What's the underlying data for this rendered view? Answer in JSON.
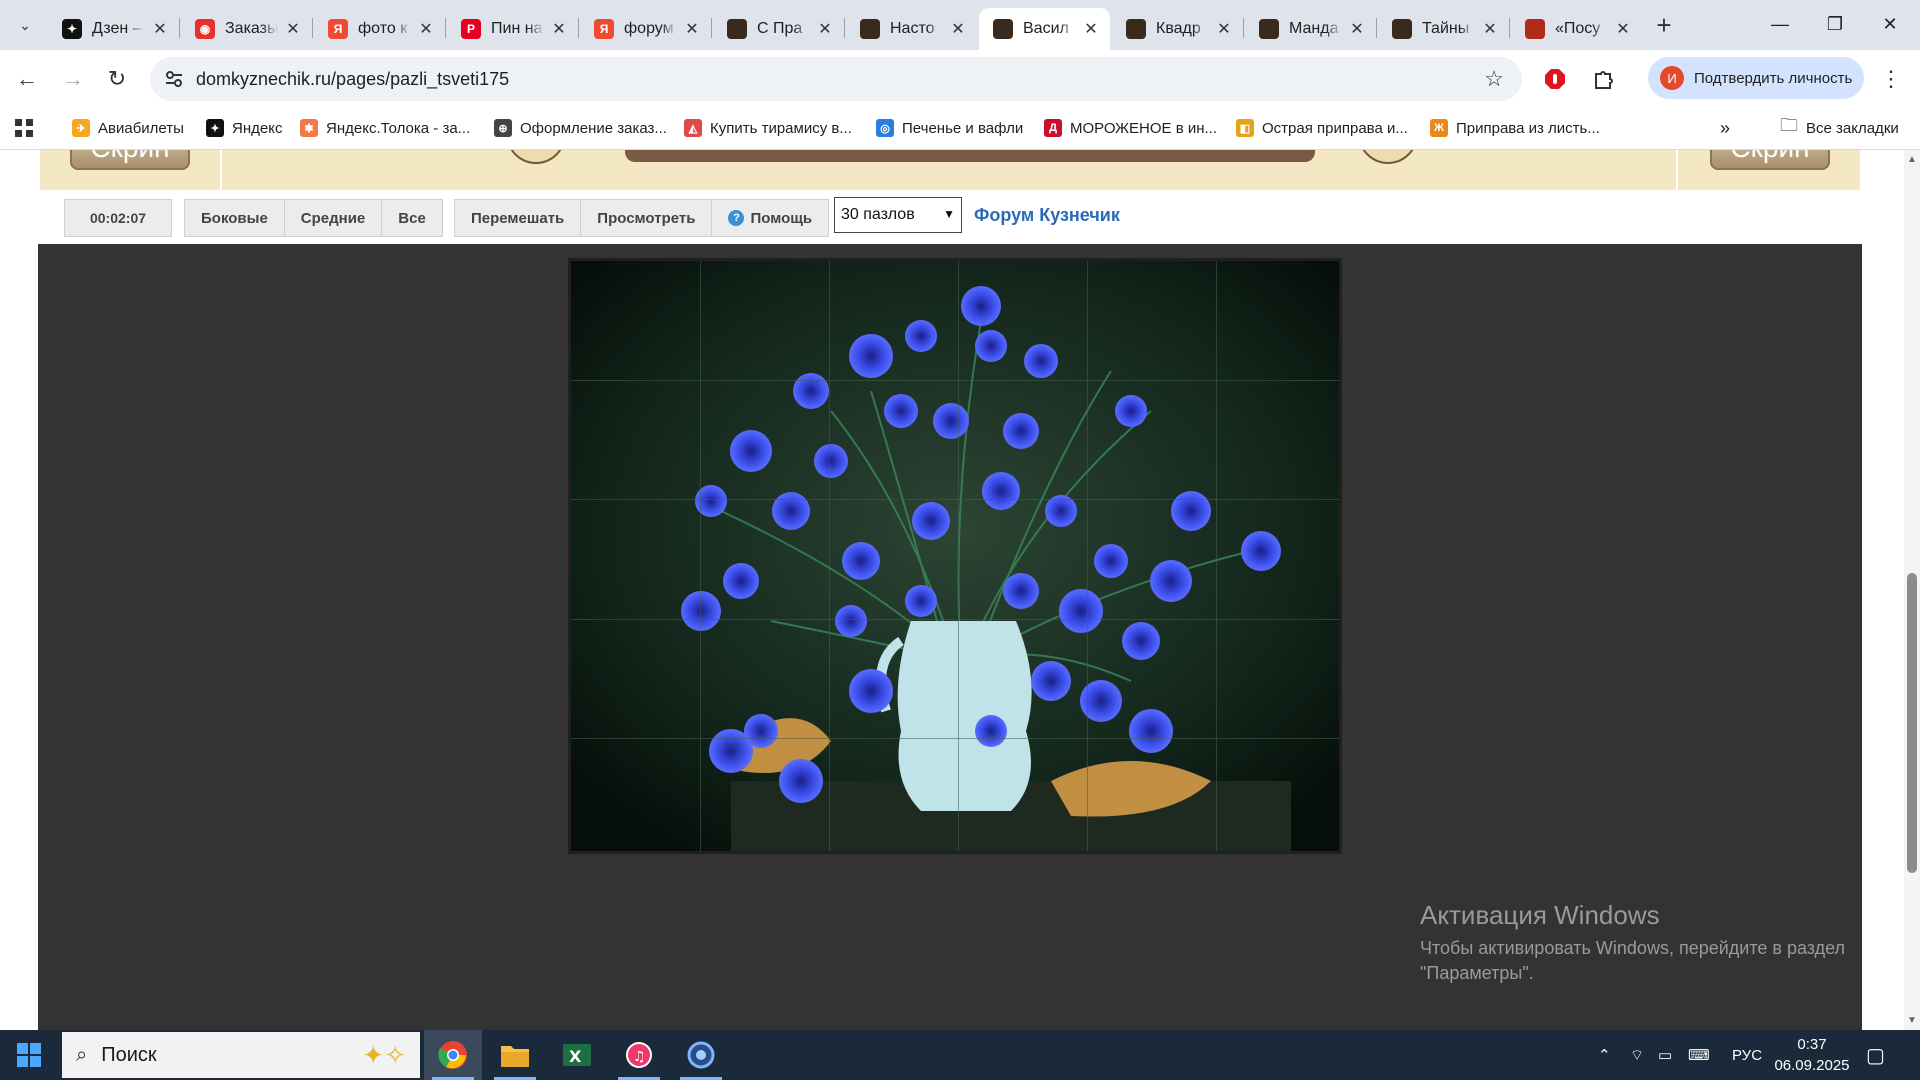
{
  "browser": {
    "tabs": [
      {
        "title": "Дзен – ",
        "color": "#111111",
        "glyph": "✦"
      },
      {
        "title": "Заказы",
        "color": "#e4322b",
        "glyph": "◉"
      },
      {
        "title": "фото к",
        "color": "#f04a31",
        "glyph": "Я"
      },
      {
        "title": "Пин на",
        "color": "#e60023",
        "glyph": "P"
      },
      {
        "title": "форум",
        "color": "#f04a31",
        "glyph": "Я"
      },
      {
        "title": "С Пра",
        "color": "#3a2a1e",
        "glyph": ""
      },
      {
        "title": "Насто",
        "color": "#3a2a1e",
        "glyph": ""
      },
      {
        "title": "Васил",
        "color": "#3a2a1e",
        "glyph": "",
        "active": true
      },
      {
        "title": "Квадр",
        "color": "#3a2a1e",
        "glyph": ""
      },
      {
        "title": "Манда",
        "color": "#3a2a1e",
        "glyph": ""
      },
      {
        "title": "Тайны",
        "color": "#3a2a1e",
        "glyph": ""
      },
      {
        "title": "«Посу",
        "color": "#b02a1a",
        "glyph": ""
      }
    ],
    "url": "domkyznechik.ru/pages/pazli_tsveti175",
    "profile_label": "Подтвердить личность",
    "profile_initial": "И",
    "bookmarks": [
      {
        "label": "Авиабилеты",
        "color": "#f5a623",
        "glyph": "✈"
      },
      {
        "label": "Яндекс",
        "color": "#111111",
        "glyph": "✦"
      },
      {
        "label": "Яндекс.Толока - за...",
        "color": "#f07a4a",
        "glyph": "✱"
      },
      {
        "label": "Оформление заказ...",
        "color": "#444444",
        "glyph": "⊕"
      },
      {
        "label": "Купить тирамису в...",
        "color": "#e24a4a",
        "glyph": "◭"
      },
      {
        "label": "Печенье и вафли",
        "color": "#2b7de0",
        "glyph": "◎"
      },
      {
        "label": "МОРОЖЕНОЕ в ин...",
        "color": "#c8102e",
        "glyph": "Д"
      },
      {
        "label": "Острая приправа и...",
        "color": "#e8a21a",
        "glyph": "◧"
      },
      {
        "label": "Приправа из листь...",
        "color": "#e8891a",
        "glyph": "Ж"
      }
    ],
    "all_bookmarks_label": "Все закладки"
  },
  "banner": {
    "screen_label": "Скрин"
  },
  "controls": {
    "timer": "00:02:07",
    "btn_side": "Боковые",
    "btn_middle": "Средние",
    "btn_all": "Все",
    "btn_shuffle": "Перемешать",
    "btn_preview": "Просмотреть",
    "btn_help": "Помощь",
    "pieces_selected": "30 пазлов",
    "forum_link": "Форум Кузнечик"
  },
  "puzzle": {
    "columns": 6,
    "rows": 5,
    "colors": {
      "background": "#0c1a12",
      "flower": "#3a4ee8",
      "vase": "#bfe3e8",
      "cloth": "#e0a24a"
    }
  },
  "watermark": {
    "title": "Активация Windows",
    "text": "Чтобы активировать Windows, перейдите в раздел \"Параметры\"."
  },
  "taskbar": {
    "search_label": "Поиск",
    "language": "РУС",
    "time": "0:37",
    "date": "06.09.2025"
  }
}
